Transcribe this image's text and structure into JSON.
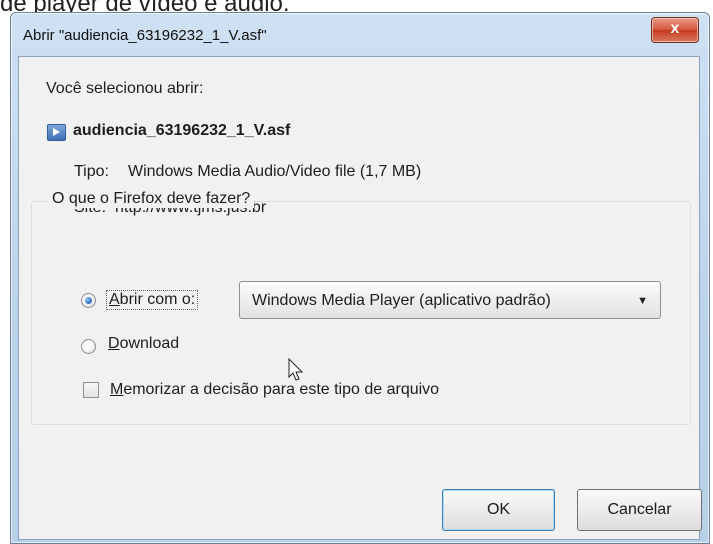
{
  "background": {
    "caption": "de player de vídeo e áudio."
  },
  "dialog": {
    "title": "Abrir \"audiencia_63196232_1_V.asf\"",
    "close_label": "x",
    "intro": "Você selecionou abrir:",
    "file": {
      "name": "audiencia_63196232_1_V.asf",
      "icon": "media-file-icon",
      "type_label": "Tipo:",
      "type_value": "Windows Media Audio/Video file (1,7 MB)",
      "site_label": "Site:",
      "site_value": "http://www.tjms.jus.br"
    },
    "group_title": "O que o Firefox deve fazer?",
    "open_with": {
      "label_underlined": "A",
      "label_rest": "brir com o:",
      "selected": true,
      "select_value": "Windows Media Player (aplicativo padrão)"
    },
    "download": {
      "label_underlined": "D",
      "label_rest": "ownload",
      "selected": false
    },
    "remember": {
      "label_underlined": "M",
      "label_rest": "emorizar a decisão para este tipo de arquivo",
      "checked": false
    },
    "ok_label": "OK",
    "cancel_label": "Cancelar"
  },
  "colors": {
    "frame": "#bcd3ec",
    "close_button": "#c63b1e",
    "dialog_background": "#f1f1f1"
  }
}
